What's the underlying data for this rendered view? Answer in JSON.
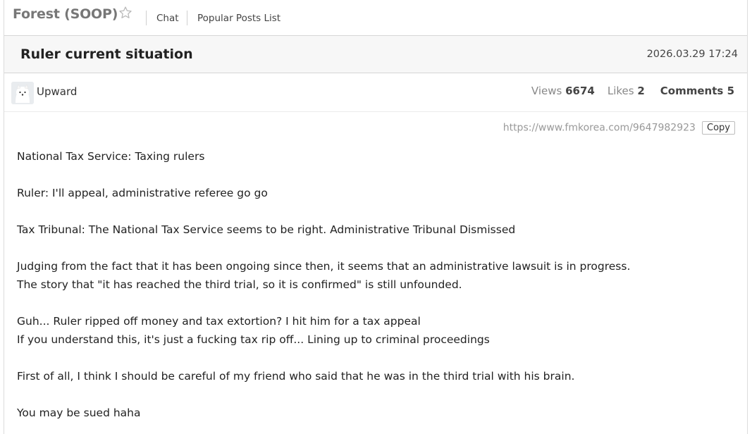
{
  "header": {
    "board_title": "Forest (SOOP)",
    "nav": [
      {
        "label": "Chat"
      },
      {
        "label": "Popular Posts List"
      }
    ]
  },
  "post": {
    "title": "Ruler current situation",
    "date": "2026.03.29 17:24",
    "author": "Upward",
    "stats": {
      "views_label": "Views",
      "views": "6674",
      "likes_label": "Likes",
      "likes": "2",
      "comments_label": "Comments",
      "comments": "5"
    },
    "url": "https://www.fmkorea.com/9647982923",
    "copy_label": "Copy",
    "body": [
      "National Tax Service: Taxing rulers",
      "",
      "Ruler: I'll appeal, administrative referee go go",
      "",
      "Tax Tribunal: The National Tax Service seems to be right. Administrative Tribunal Dismissed",
      "",
      "Judging from the fact that it has been ongoing since then, it seems that an administrative lawsuit is in progress.",
      "The story that \"it has reached the third trial, so it is confirmed\" is still unfounded.",
      "",
      "Guh... Ruler ripped off money and tax extortion? I hit him for a tax appeal",
      "If you understand this, it's just a fucking tax rip off... Lining up to criminal proceedings",
      "",
      "First of all, I think I should be careful of my friend who said that he was in the third trial with his brain.",
      "",
      "You may be sued haha"
    ]
  },
  "icons": {
    "star": "star-outline-icon",
    "avatar": "samoyed-avatar"
  },
  "colors": {
    "board_title": "#777777",
    "header_background": "#f7f7f7",
    "url_text": "#999999"
  }
}
